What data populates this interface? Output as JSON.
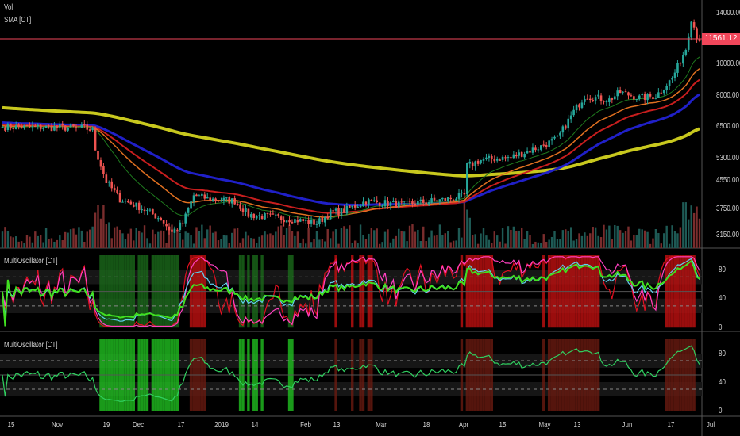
{
  "legend": {
    "vol": "Vol",
    "sma": "SMA [CT]",
    "osc1": "MultiOscillator [CT]",
    "osc2": "MultiOscillator [CT]"
  },
  "price_axis": [
    "14000.00",
    "10000.00",
    "8000.00",
    "6500.00",
    "5300.00",
    "4550.00",
    "3750.00",
    "3150.00"
  ],
  "last_price": "11561.12",
  "osc_axis": [
    "80",
    "40",
    "0"
  ],
  "osc2_axis": [
    "80",
    "40",
    "0"
  ],
  "x_axis": [
    "15",
    "Nov",
    "19",
    "Dec",
    "17",
    "2019",
    "14",
    "Feb",
    "13",
    "Mar",
    "18",
    "Apr",
    "15",
    "May",
    "13",
    "Jun",
    "17",
    "Jul"
  ],
  "colors": {
    "up": "#26a69a",
    "down": "#ef5350",
    "last": "#f0465a",
    "sma200": "#c8c81e",
    "blue": "#2020c8",
    "red": "#c81e1e",
    "orange": "#e07020",
    "green": "#1e7a1e"
  },
  "chart_data": {
    "type": "candlestick",
    "title": "Price with SMA ribbon, volume and MultiOscillator",
    "bars": 256,
    "price_keypoints": [
      [
        0,
        6500
      ],
      [
        30,
        6450
      ],
      [
        33,
        6350
      ],
      [
        34,
        5600
      ],
      [
        38,
        4500
      ],
      [
        43,
        4000
      ],
      [
        50,
        3800
      ],
      [
        58,
        3500
      ],
      [
        62,
        3200
      ],
      [
        66,
        3400
      ],
      [
        70,
        4100
      ],
      [
        76,
        4000
      ],
      [
        85,
        3950
      ],
      [
        90,
        3600
      ],
      [
        105,
        3500
      ],
      [
        115,
        3400
      ],
      [
        120,
        3650
      ],
      [
        125,
        3700
      ],
      [
        133,
        3950
      ],
      [
        146,
        3850
      ],
      [
        163,
        4000
      ],
      [
        169,
        4100
      ],
      [
        170,
        5000
      ],
      [
        175,
        5200
      ],
      [
        186,
        5300
      ],
      [
        197,
        5700
      ],
      [
        203,
        6000
      ],
      [
        209,
        7200
      ],
      [
        213,
        8000
      ],
      [
        222,
        7800
      ],
      [
        226,
        8200
      ],
      [
        233,
        7900
      ],
      [
        239,
        8000
      ],
      [
        245,
        9000
      ],
      [
        250,
        11000
      ],
      [
        252,
        13500
      ],
      [
        254,
        12000
      ],
      [
        255,
        11561
      ]
    ],
    "price_scale": "log",
    "ylim": [
      3000,
      15000
    ],
    "oscillator_range": [
      0,
      100
    ]
  }
}
